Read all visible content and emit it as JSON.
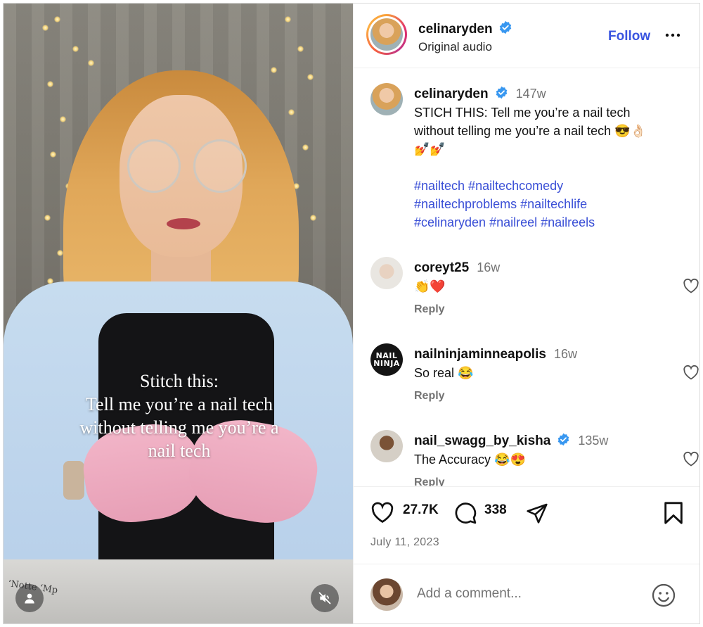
{
  "video": {
    "caption_lines": [
      "Stitch this:",
      "Tell me you’re a nail tech",
      "without telling me you’re a",
      "nail tech"
    ],
    "table_label": "ʻNotte ʻMp",
    "muted": true
  },
  "header": {
    "username": "celinaryden",
    "verified": true,
    "subtitle": "Original audio",
    "follow_label": "Follow",
    "more_label": "•••"
  },
  "post": {
    "username": "celinaryden",
    "time": "147w",
    "caption_line1": "STICH THIS: Tell me you’re a nail tech",
    "caption_line2": "without telling me you’re a nail tech 😎👌🏻",
    "caption_line3": "💅💅",
    "hashtags_line1": "#nailtech #nailtechcomedy",
    "hashtags_line2": "#nailtechproblems #nailtechlife",
    "hashtags_line3": "#celinaryden #nailreel #nailreels"
  },
  "comments": [
    {
      "username": "coreyt25",
      "time": "16w",
      "text": "👏❤️",
      "reply_label": "Reply",
      "verified": false
    },
    {
      "username": "nailninjaminneapolis",
      "time": "16w",
      "text": "So real 😂",
      "reply_label": "Reply",
      "verified": false,
      "avatar_text": [
        "NAIL",
        "NINJA"
      ]
    },
    {
      "username": "nail_swagg_by_kisha",
      "time": "135w",
      "text": "The Accuracy 😂😍",
      "reply_label": "Reply",
      "verified": true
    }
  ],
  "actions": {
    "likes": "27.7K",
    "comments": "338",
    "date": "July 11, 2023"
  },
  "add_comment": {
    "placeholder": "Add a comment..."
  },
  "colors": {
    "link_blue": "#3a55e0",
    "hashtag_blue": "#3a4fd6",
    "verified_blue": "#3897f0",
    "muted_gray": "#737373"
  }
}
